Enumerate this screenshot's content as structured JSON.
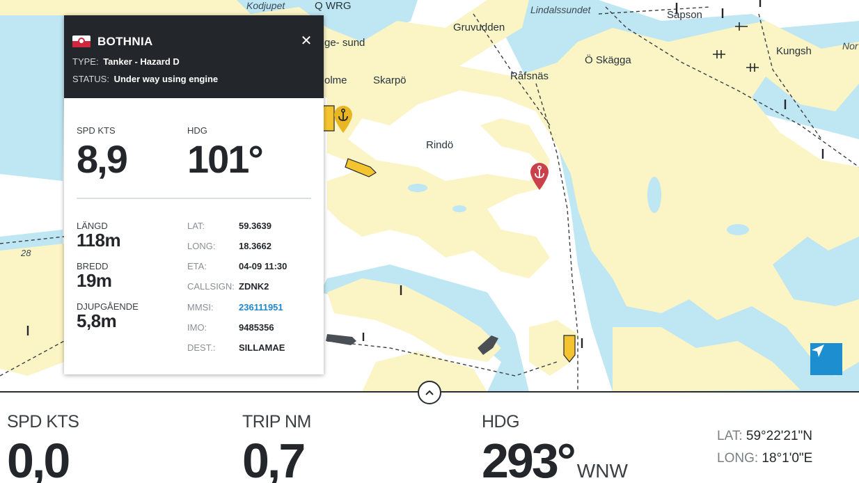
{
  "map": {
    "places": [
      {
        "name": "Kodjupet",
        "italic": true
      },
      {
        "name": "Q WRG",
        "italic": false
      },
      {
        "name": "Lindalssundet",
        "italic": true
      },
      {
        "name": "Gruvudden",
        "italic": false
      },
      {
        "name": "ge- sund",
        "italic": false
      },
      {
        "name": "Skarpö",
        "italic": false
      },
      {
        "name": "olme",
        "italic": false
      },
      {
        "name": "Råfsnäs",
        "italic": false
      },
      {
        "name": "Ö Skägga",
        "italic": false
      },
      {
        "name": "Kungsh",
        "italic": false
      },
      {
        "name": "Nor",
        "italic": true
      },
      {
        "name": "Sapson",
        "italic": false
      },
      {
        "name": "Rindö",
        "italic": false
      },
      {
        "name": "28",
        "italic": true
      }
    ],
    "colors": {
      "land": "#fbf4c4",
      "shallow": "#bfe6f3",
      "deep": "#ffffff",
      "anchor": "#c8414b",
      "vessel": "#f4c430",
      "dark_vessel": "#4a4f55",
      "locate": "#1d8fd1"
    }
  },
  "vessel_popup": {
    "name": "BOTHNIA",
    "type_label": "TYPE:",
    "type_value": "Tanker - Hazard D",
    "status_label": "STATUS:",
    "status_value": "Under way using engine",
    "speed": {
      "label": "SPD KTS",
      "value": "8,9"
    },
    "heading": {
      "label": "HDG",
      "value": "101°"
    },
    "length": {
      "label": "LÄNGD",
      "value": "118m"
    },
    "beam": {
      "label": "BREDD",
      "value": "19m"
    },
    "draught": {
      "label": "DJUPGÅENDE",
      "value": "5,8m"
    },
    "details": [
      {
        "key": "LAT:",
        "value": "59.3639"
      },
      {
        "key": "LONG:",
        "value": "18.3662"
      },
      {
        "key": "ETA:",
        "value": "04-09 11:30"
      },
      {
        "key": "CALLSIGN:",
        "value": "ZDNK2"
      },
      {
        "key": "MMSI:",
        "value": "236111951"
      },
      {
        "key": "IMO:",
        "value": "9485356"
      },
      {
        "key": "DEST.:",
        "value": "SILLAMAE"
      }
    ]
  },
  "bottom_bar": {
    "speed": {
      "label": "SPD KTS",
      "value": "0,0"
    },
    "trip": {
      "label": "TRIP NM",
      "value": "0,7"
    },
    "heading": {
      "label": "HDG",
      "value": "293°",
      "direction": "WNW"
    },
    "lat": {
      "label": "LAT:",
      "value": "59°22'21\"N"
    },
    "long": {
      "label": "LONG:",
      "value": "18°1'0\"E"
    }
  }
}
